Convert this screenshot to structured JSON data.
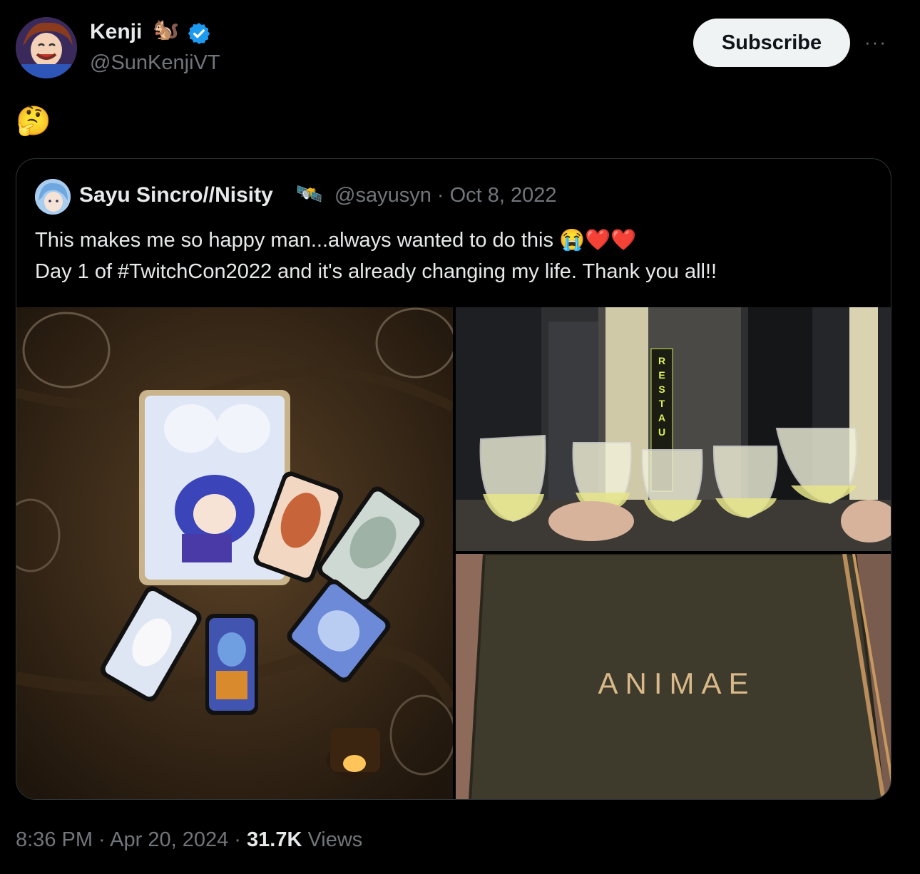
{
  "author": {
    "name": "Kenji",
    "badge_emoji": "🐿️",
    "verified_icon": "verified-badge-icon",
    "handle": "@SunKenjiVT"
  },
  "actions": {
    "subscribe_label": "Subscribe",
    "more_label": "···"
  },
  "tweet": {
    "text": "🤔"
  },
  "quoted": {
    "name": "Sayu Sincro//Nisity",
    "name_emoji": "🛰️",
    "handle_date": "@sayusyn · Oct 8, 2022",
    "line1": "This makes me so happy man...always wanted to do this 😭❤️❤️",
    "line2": "Day 1 of #TwitchCon2022 and it's already changing my life. Thank you all!!",
    "menu_text": "ANIMAE",
    "sign_text": "RESTAU"
  },
  "footer": {
    "time": "8:36 PM · Apr 20, 2024 · ",
    "views_count": "31.7K",
    "views_label": " Views"
  },
  "colors": {
    "background": "#000000",
    "text": "#e7e9ea",
    "muted": "#71767b",
    "verified": "#1d9bf0",
    "border": "#2f3336"
  }
}
